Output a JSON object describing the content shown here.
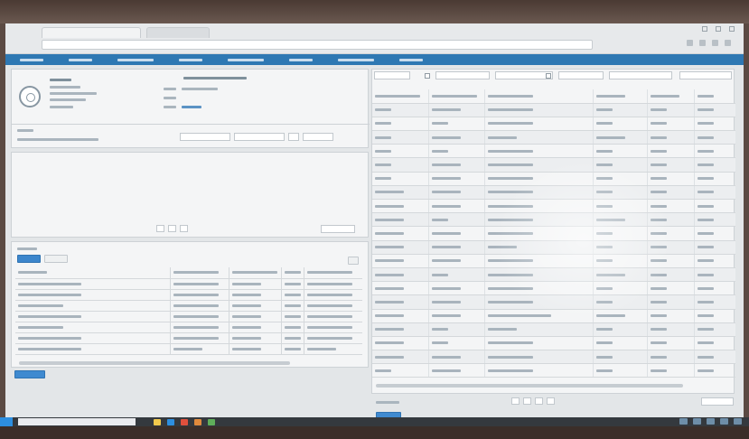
{
  "screen": {
    "accent": "#2e78b3",
    "button": "#3f8ad0",
    "background": "#e3e6e8"
  },
  "browser": {
    "tab_title": "",
    "url": "",
    "icons": [
      "back-icon",
      "forward-icon",
      "refresh-icon",
      "home-icon",
      "star-icon",
      "menu-icon"
    ]
  },
  "nav": {
    "items": [
      "",
      "",
      "",
      "",
      "",
      "",
      "",
      ""
    ]
  },
  "patient": {
    "name": "",
    "details": [
      "",
      "",
      "",
      ""
    ],
    "fields": [
      "",
      "",
      ""
    ]
  },
  "left_table": {
    "headers": [
      "",
      "",
      "",
      "",
      ""
    ],
    "rows": 7,
    "tabs": [
      "",
      ""
    ],
    "bottom_button": ""
  },
  "right_table": {
    "headers": [
      "",
      "",
      "",
      "",
      "",
      ""
    ],
    "rows": 21,
    "footer_button": "",
    "pager_label": ""
  },
  "taskbar": {
    "search_placeholder": "",
    "icons": [
      "start-icon",
      "explorer-icon",
      "edge-icon",
      "chrome-icon",
      "app-icon"
    ]
  }
}
